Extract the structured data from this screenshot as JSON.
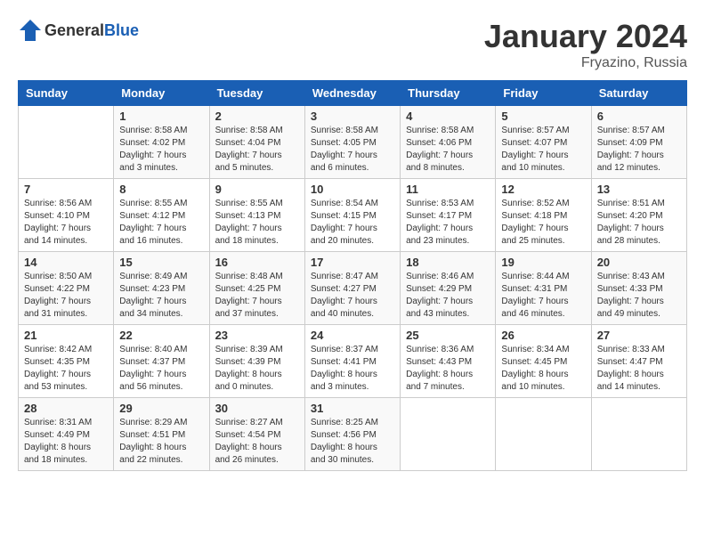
{
  "header": {
    "logo_general": "General",
    "logo_blue": "Blue",
    "month_year": "January 2024",
    "location": "Fryazino, Russia"
  },
  "days_of_week": [
    "Sunday",
    "Monday",
    "Tuesday",
    "Wednesday",
    "Thursday",
    "Friday",
    "Saturday"
  ],
  "weeks": [
    [
      {
        "day": "",
        "sunrise": "",
        "sunset": "",
        "daylight": ""
      },
      {
        "day": "1",
        "sunrise": "Sunrise: 8:58 AM",
        "sunset": "Sunset: 4:02 PM",
        "daylight": "Daylight: 7 hours and 3 minutes."
      },
      {
        "day": "2",
        "sunrise": "Sunrise: 8:58 AM",
        "sunset": "Sunset: 4:04 PM",
        "daylight": "Daylight: 7 hours and 5 minutes."
      },
      {
        "day": "3",
        "sunrise": "Sunrise: 8:58 AM",
        "sunset": "Sunset: 4:05 PM",
        "daylight": "Daylight: 7 hours and 6 minutes."
      },
      {
        "day": "4",
        "sunrise": "Sunrise: 8:58 AM",
        "sunset": "Sunset: 4:06 PM",
        "daylight": "Daylight: 7 hours and 8 minutes."
      },
      {
        "day": "5",
        "sunrise": "Sunrise: 8:57 AM",
        "sunset": "Sunset: 4:07 PM",
        "daylight": "Daylight: 7 hours and 10 minutes."
      },
      {
        "day": "6",
        "sunrise": "Sunrise: 8:57 AM",
        "sunset": "Sunset: 4:09 PM",
        "daylight": "Daylight: 7 hours and 12 minutes."
      }
    ],
    [
      {
        "day": "7",
        "sunrise": "Sunrise: 8:56 AM",
        "sunset": "Sunset: 4:10 PM",
        "daylight": "Daylight: 7 hours and 14 minutes."
      },
      {
        "day": "8",
        "sunrise": "Sunrise: 8:55 AM",
        "sunset": "Sunset: 4:12 PM",
        "daylight": "Daylight: 7 hours and 16 minutes."
      },
      {
        "day": "9",
        "sunrise": "Sunrise: 8:55 AM",
        "sunset": "Sunset: 4:13 PM",
        "daylight": "Daylight: 7 hours and 18 minutes."
      },
      {
        "day": "10",
        "sunrise": "Sunrise: 8:54 AM",
        "sunset": "Sunset: 4:15 PM",
        "daylight": "Daylight: 7 hours and 20 minutes."
      },
      {
        "day": "11",
        "sunrise": "Sunrise: 8:53 AM",
        "sunset": "Sunset: 4:17 PM",
        "daylight": "Daylight: 7 hours and 23 minutes."
      },
      {
        "day": "12",
        "sunrise": "Sunrise: 8:52 AM",
        "sunset": "Sunset: 4:18 PM",
        "daylight": "Daylight: 7 hours and 25 minutes."
      },
      {
        "day": "13",
        "sunrise": "Sunrise: 8:51 AM",
        "sunset": "Sunset: 4:20 PM",
        "daylight": "Daylight: 7 hours and 28 minutes."
      }
    ],
    [
      {
        "day": "14",
        "sunrise": "Sunrise: 8:50 AM",
        "sunset": "Sunset: 4:22 PM",
        "daylight": "Daylight: 7 hours and 31 minutes."
      },
      {
        "day": "15",
        "sunrise": "Sunrise: 8:49 AM",
        "sunset": "Sunset: 4:23 PM",
        "daylight": "Daylight: 7 hours and 34 minutes."
      },
      {
        "day": "16",
        "sunrise": "Sunrise: 8:48 AM",
        "sunset": "Sunset: 4:25 PM",
        "daylight": "Daylight: 7 hours and 37 minutes."
      },
      {
        "day": "17",
        "sunrise": "Sunrise: 8:47 AM",
        "sunset": "Sunset: 4:27 PM",
        "daylight": "Daylight: 7 hours and 40 minutes."
      },
      {
        "day": "18",
        "sunrise": "Sunrise: 8:46 AM",
        "sunset": "Sunset: 4:29 PM",
        "daylight": "Daylight: 7 hours and 43 minutes."
      },
      {
        "day": "19",
        "sunrise": "Sunrise: 8:44 AM",
        "sunset": "Sunset: 4:31 PM",
        "daylight": "Daylight: 7 hours and 46 minutes."
      },
      {
        "day": "20",
        "sunrise": "Sunrise: 8:43 AM",
        "sunset": "Sunset: 4:33 PM",
        "daylight": "Daylight: 7 hours and 49 minutes."
      }
    ],
    [
      {
        "day": "21",
        "sunrise": "Sunrise: 8:42 AM",
        "sunset": "Sunset: 4:35 PM",
        "daylight": "Daylight: 7 hours and 53 minutes."
      },
      {
        "day": "22",
        "sunrise": "Sunrise: 8:40 AM",
        "sunset": "Sunset: 4:37 PM",
        "daylight": "Daylight: 7 hours and 56 minutes."
      },
      {
        "day": "23",
        "sunrise": "Sunrise: 8:39 AM",
        "sunset": "Sunset: 4:39 PM",
        "daylight": "Daylight: 8 hours and 0 minutes."
      },
      {
        "day": "24",
        "sunrise": "Sunrise: 8:37 AM",
        "sunset": "Sunset: 4:41 PM",
        "daylight": "Daylight: 8 hours and 3 minutes."
      },
      {
        "day": "25",
        "sunrise": "Sunrise: 8:36 AM",
        "sunset": "Sunset: 4:43 PM",
        "daylight": "Daylight: 8 hours and 7 minutes."
      },
      {
        "day": "26",
        "sunrise": "Sunrise: 8:34 AM",
        "sunset": "Sunset: 4:45 PM",
        "daylight": "Daylight: 8 hours and 10 minutes."
      },
      {
        "day": "27",
        "sunrise": "Sunrise: 8:33 AM",
        "sunset": "Sunset: 4:47 PM",
        "daylight": "Daylight: 8 hours and 14 minutes."
      }
    ],
    [
      {
        "day": "28",
        "sunrise": "Sunrise: 8:31 AM",
        "sunset": "Sunset: 4:49 PM",
        "daylight": "Daylight: 8 hours and 18 minutes."
      },
      {
        "day": "29",
        "sunrise": "Sunrise: 8:29 AM",
        "sunset": "Sunset: 4:51 PM",
        "daylight": "Daylight: 8 hours and 22 minutes."
      },
      {
        "day": "30",
        "sunrise": "Sunrise: 8:27 AM",
        "sunset": "Sunset: 4:54 PM",
        "daylight": "Daylight: 8 hours and 26 minutes."
      },
      {
        "day": "31",
        "sunrise": "Sunrise: 8:25 AM",
        "sunset": "Sunset: 4:56 PM",
        "daylight": "Daylight: 8 hours and 30 minutes."
      },
      {
        "day": "",
        "sunrise": "",
        "sunset": "",
        "daylight": ""
      },
      {
        "day": "",
        "sunrise": "",
        "sunset": "",
        "daylight": ""
      },
      {
        "day": "",
        "sunrise": "",
        "sunset": "",
        "daylight": ""
      }
    ]
  ]
}
